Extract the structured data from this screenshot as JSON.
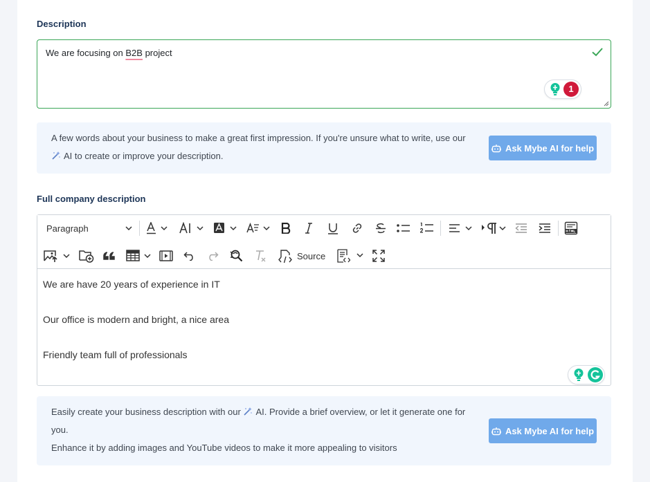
{
  "description": {
    "label": "Description",
    "value": "We are focusing on ",
    "value_highlight": "B2B",
    "value_rest": " project",
    "grammarly_count": "1"
  },
  "hint1": {
    "line1": "A few words about your business to make a great first impression. If you're unsure what to write, use our",
    "line2": "AI to create or improve your description.",
    "button": "Ask Mybe AI for help"
  },
  "full_description": {
    "label": "Full company description",
    "paragraph_style": "Paragraph",
    "source_label": "Source",
    "paragraphs": [
      "We are have 20 years of experience in IT",
      "Our office is modern and bright, a nice area",
      "Friendly team full of professionals"
    ]
  },
  "hint2": {
    "line1_pre": "Easily create your business description with our",
    "line1_post": "AI. Provide a brief overview, or let it generate one for",
    "line2": "you.",
    "line3": "Enhance it by adding images and YouTube videos to make it more appealing to visitors",
    "button": "Ask Mybe AI for help"
  },
  "colors": {
    "valid_border": "#3aa657",
    "hint_bg": "#f1f6fd",
    "ai_button": "#70a9ea",
    "grammarly_red": "#d0193a",
    "grammarly_green": "#15c39a"
  }
}
